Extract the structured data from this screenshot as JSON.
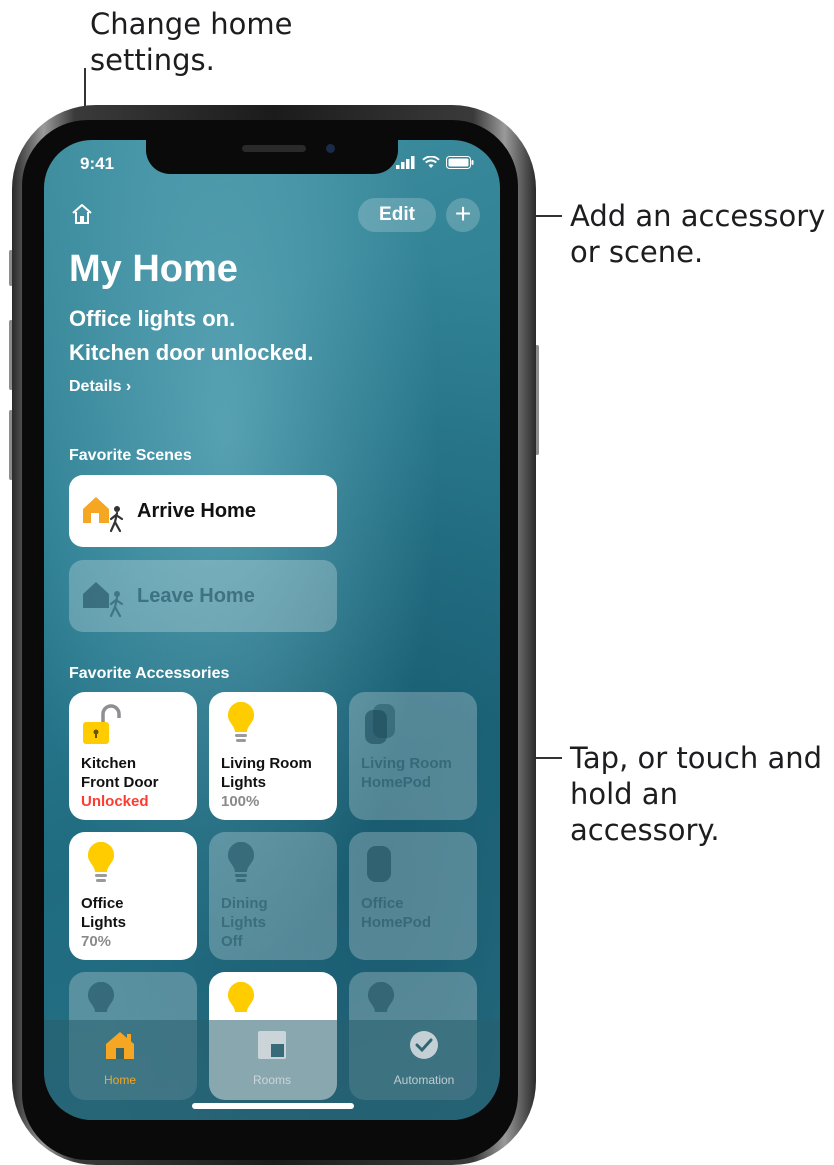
{
  "callouts": {
    "settings": [
      "Change home",
      "settings."
    ],
    "add": [
      "Add an accessory",
      "or scene."
    ],
    "tap": [
      "Tap, or touch and",
      "hold an accessory."
    ]
  },
  "status_bar": {
    "time": "9:41"
  },
  "header": {
    "home_icon": "house-outline-icon",
    "edit_label": "Edit",
    "add_label": "+"
  },
  "home": {
    "title": "My Home",
    "status_lines": [
      "Office lights on.",
      "Kitchen door unlocked."
    ],
    "details_label": "Details ›"
  },
  "favorite_scenes": {
    "title": "Favorite Scenes",
    "items": [
      {
        "label": "Arrive Home",
        "icon": "arrive-home-icon",
        "active": true
      },
      {
        "label": "Leave Home",
        "icon": "leave-home-icon",
        "active": false
      }
    ]
  },
  "favorite_accessories": {
    "title": "Favorite Accessories",
    "items": [
      {
        "name_lines": [
          "Kitchen",
          "Front Door"
        ],
        "status": "Unlocked",
        "icon": "lock-open-icon",
        "active": true,
        "alert": true
      },
      {
        "name_lines": [
          "Living Room",
          "Lights"
        ],
        "status": "100%",
        "icon": "lightbulb-icon",
        "active": true,
        "alert": false
      },
      {
        "name_lines": [
          "Living Room",
          "HomePod"
        ],
        "status": "",
        "icon": "homepod-icon",
        "active": false,
        "alert": false
      },
      {
        "name_lines": [
          "Office",
          "Lights"
        ],
        "status": "70%",
        "icon": "lightbulb-icon",
        "active": true,
        "alert": false
      },
      {
        "name_lines": [
          "Dining",
          "Lights"
        ],
        "status": "Off",
        "icon": "lightbulb-icon",
        "active": false,
        "alert": false
      },
      {
        "name_lines": [
          "Office",
          "HomePod"
        ],
        "status": "",
        "icon": "homepod-icon",
        "active": false,
        "alert": false
      }
    ]
  },
  "tab_bar": {
    "tabs": [
      {
        "label": "Home",
        "icon": "house-filled-icon",
        "selected": true
      },
      {
        "label": "Rooms",
        "icon": "rooms-icon",
        "selected": false
      },
      {
        "label": "Automation",
        "icon": "clock-icon",
        "selected": false
      }
    ]
  },
  "colors": {
    "accent": "#f5a623",
    "bulb_on": "#ffcc00",
    "alert": "#ff3b30",
    "background": "#2d7e92"
  }
}
